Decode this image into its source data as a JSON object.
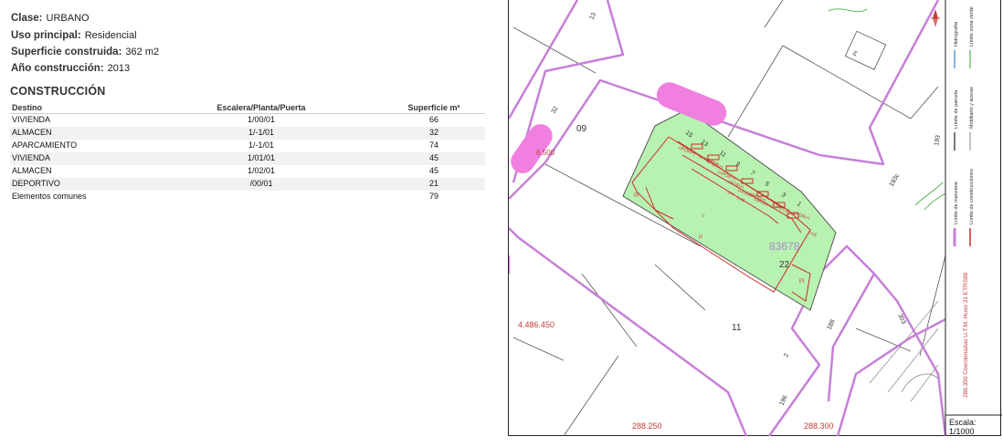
{
  "info": {
    "clase": {
      "label": "Clase:",
      "value": "URBANO"
    },
    "uso": {
      "label": "Uso principal:",
      "value": "Residencial"
    },
    "superficie": {
      "label": "Superficie construida:",
      "value": "362 m2"
    },
    "anio": {
      "label": "Año construcción:",
      "value": "2013"
    }
  },
  "construccion": {
    "title": "CONSTRUCCIÓN",
    "headers": [
      "Destino",
      "Escalera/Planta/Puerta",
      "Superficie m²"
    ],
    "rows": [
      [
        "VIVIENDA",
        "1/00/01",
        "66"
      ],
      [
        "ALMACEN",
        "1/-1/01",
        "32"
      ],
      [
        "APARCAMIENTO",
        "1/-1/01",
        "74"
      ],
      [
        "VIVIENDA",
        "1/01/01",
        "45"
      ],
      [
        "ALMACEN",
        "1/02/01",
        "45"
      ],
      [
        "DEPORTIVO",
        "/00/01",
        "21"
      ],
      [
        "Elementos comunes",
        "",
        "79"
      ]
    ]
  },
  "map": {
    "block_labels": [
      "09",
      "22",
      "11"
    ],
    "parcel_ref": "83678",
    "parcel_inner_labels": [
      "P",
      "PI",
      "PI"
    ],
    "corner_label": "PI",
    "street_numbers": [
      "13",
      "32",
      "15",
      "13",
      "11",
      "9",
      "7",
      "5",
      "3",
      "1",
      "193c",
      "193",
      "188",
      "303",
      "2",
      "196"
    ],
    "construction_tags": [
      "+POR+I",
      "-I+POR+I",
      "+POR+I",
      "I+POR+I",
      "+POR+I",
      "I+POR+I",
      "+POR+I",
      "I+POR+I",
      "I+POR+I",
      "+POR+I",
      "-I+II",
      "-I+I",
      "-I+II",
      "-I"
    ],
    "coord_north": "4.486.450",
    "coord_north_partial": "6.500",
    "coord_east_1": "288.250",
    "coord_east_2": "288.300",
    "vertical_coord_text": "288.350 Coordenadas U.T.M. Huso 31 ETRS89",
    "legend": {
      "manzana": "Límite de manzana",
      "construcciones": "Límite de construcciones",
      "parcela": "Límite de parcela",
      "mobiliario": "Mobiliario y aceras",
      "hidrografia": "Hidrografía",
      "zona_verde": "Límite zona verde"
    },
    "scale_label": "Escala:",
    "scale_value": "1/1000",
    "colors": {
      "block": "#c77fd8",
      "parcel": "#b8f2b0",
      "construction": "#cc2a2a",
      "highlight": "#f07fe0",
      "coord": "#c43b3b"
    }
  }
}
